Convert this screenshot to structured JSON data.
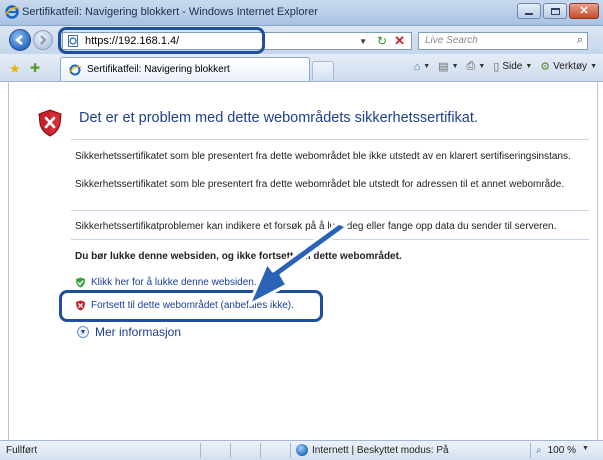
{
  "window": {
    "title": "Sertifikatfeil: Navigering blokkert - Windows Internet Explorer"
  },
  "address_bar": {
    "url": "https://192.168.1.4/",
    "search_placeholder": "Live Search"
  },
  "tab": {
    "label": "Sertifikatfeil: Navigering blokkert"
  },
  "toolbar": {
    "page_label": "Side",
    "tools_label": "Verktøy"
  },
  "page": {
    "heading": "Det er et problem med dette webområdets sikkerhetssertifikat.",
    "para1": "Sikkerhetssertifikatet som ble presentert fra dette webområdet ble ikke utstedt av en klarert sertifiseringsinstans.",
    "para2": "Sikkerhetssertifikatet som ble presentert fra dette webområdet ble utstedt for adressen til et annet webområde.",
    "para3": "Sikkerhetssertifikatproblemer kan indikere et forsøk på å lure deg eller fange opp data du sender til serveren.",
    "recommendation": "Du bør lukke denne websiden, og ikke fortsette til dette webområdet.",
    "close_link": "Klikk her for å lukke denne websiden.",
    "continue_link": "Fortsett til dette webområdet (anbefales ikke).",
    "more_info": "Mer informasjon"
  },
  "status": {
    "left": "Fullført",
    "zone": "Internett | Beskyttet modus: På",
    "zoom": "100 %"
  },
  "icons": {
    "shield": "shield-error-icon",
    "close_link": "shield-ok-icon",
    "continue_link": "shield-error-small-icon",
    "more_info": "chevron-down-circle-icon",
    "zoom": "magnifier-icon"
  },
  "colors": {
    "heading": "#1f3f8f",
    "link": "#1a3d9a",
    "highlight": "#1f4e9a",
    "error_red": "#c0282d"
  }
}
